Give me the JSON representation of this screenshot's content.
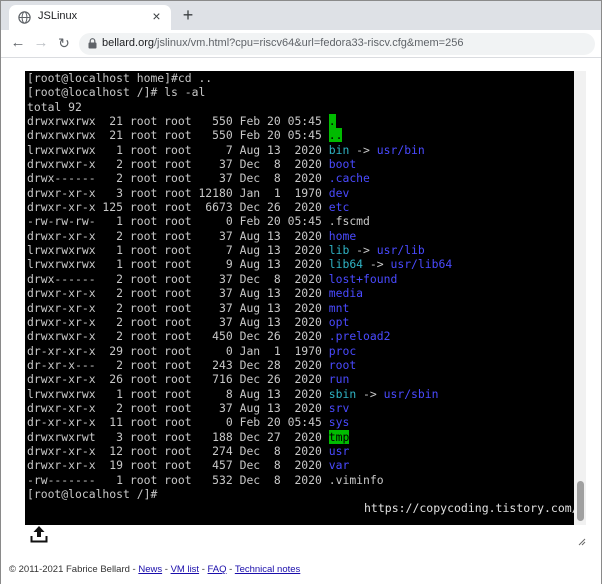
{
  "browser": {
    "tab_title": "JSLinux",
    "new_tab_symbol": "+",
    "close_symbol": "×",
    "url_host": "bellard.org",
    "url_path": "/jslinux/vm.html?cpu=riscv64&url=fedora33-riscv.cfg&mem=256"
  },
  "terminal": {
    "lines": [
      [
        {
          "t": "[root@localhost home]#cd .."
        }
      ],
      [
        {
          "t": "[root@localhost /]# ls -al"
        }
      ],
      [
        {
          "t": "total 92"
        }
      ],
      [
        {
          "t": "drwxrwxrwx  21 root root   550 Feb 20 05:45 "
        },
        {
          "t": ".",
          "c": "c-green-bg"
        }
      ],
      [
        {
          "t": "drwxrwxrwx  21 root root   550 Feb 20 05:45 "
        },
        {
          "t": "..",
          "c": "c-green-bg"
        }
      ],
      [
        {
          "t": "lrwxrwxrwx   1 root root     7 Aug 13  2020 "
        },
        {
          "t": "bin",
          "c": "c-cyan"
        },
        {
          "t": " -> "
        },
        {
          "t": "usr/bin",
          "c": "c-blue"
        }
      ],
      [
        {
          "t": "drwxrwxr-x   2 root root    37 Dec  8  2020 "
        },
        {
          "t": "boot",
          "c": "c-blue"
        }
      ],
      [
        {
          "t": "drwx------   2 root root    37 Dec  8  2020 "
        },
        {
          "t": ".cache",
          "c": "c-blue"
        }
      ],
      [
        {
          "t": "drwxr-xr-x   3 root root 12180 Jan  1  1970 "
        },
        {
          "t": "dev",
          "c": "c-blue"
        }
      ],
      [
        {
          "t": "drwxr-xr-x 125 root root  6673 Dec 26  2020 "
        },
        {
          "t": "etc",
          "c": "c-blue"
        }
      ],
      [
        {
          "t": "-rw-rw-rw-   1 root root     0 Feb 20 05:45 .fscmd"
        }
      ],
      [
        {
          "t": "drwxr-xr-x   2 root root    37 Aug 13  2020 "
        },
        {
          "t": "home",
          "c": "c-blue"
        }
      ],
      [
        {
          "t": "lrwxrwxrwx   1 root root     7 Aug 13  2020 "
        },
        {
          "t": "lib",
          "c": "c-cyan"
        },
        {
          "t": " -> "
        },
        {
          "t": "usr/lib",
          "c": "c-blue"
        }
      ],
      [
        {
          "t": "lrwxrwxrwx   1 root root     9 Aug 13  2020 "
        },
        {
          "t": "lib64",
          "c": "c-cyan"
        },
        {
          "t": " -> "
        },
        {
          "t": "usr/lib64",
          "c": "c-blue"
        }
      ],
      [
        {
          "t": "drwx------   2 root root    37 Dec  8  2020 "
        },
        {
          "t": "lost+found",
          "c": "c-blue"
        }
      ],
      [
        {
          "t": "drwxr-xr-x   2 root root    37 Aug 13  2020 "
        },
        {
          "t": "media",
          "c": "c-blue"
        }
      ],
      [
        {
          "t": "drwxr-xr-x   2 root root    37 Aug 13  2020 "
        },
        {
          "t": "mnt",
          "c": "c-blue"
        }
      ],
      [
        {
          "t": "drwxr-xr-x   2 root root    37 Aug 13  2020 "
        },
        {
          "t": "opt",
          "c": "c-blue"
        }
      ],
      [
        {
          "t": "drwxrwxr-x   2 root root   450 Dec 26  2020 "
        },
        {
          "t": ".preload2",
          "c": "c-blue"
        }
      ],
      [
        {
          "t": "dr-xr-xr-x  29 root root     0 Jan  1  1970 "
        },
        {
          "t": "proc",
          "c": "c-blue"
        }
      ],
      [
        {
          "t": "dr-xr-x---   2 root root   243 Dec 28  2020 "
        },
        {
          "t": "root",
          "c": "c-blue"
        }
      ],
      [
        {
          "t": "drwxr-xr-x  26 root root   716 Dec 26  2020 "
        },
        {
          "t": "run",
          "c": "c-blue"
        }
      ],
      [
        {
          "t": "lrwxrwxrwx   1 root root     8 Aug 13  2020 "
        },
        {
          "t": "sbin",
          "c": "c-cyan"
        },
        {
          "t": " -> "
        },
        {
          "t": "usr/sbin",
          "c": "c-blue"
        }
      ],
      [
        {
          "t": "drwxr-xr-x   2 root root    37 Aug 13  2020 "
        },
        {
          "t": "srv",
          "c": "c-blue"
        }
      ],
      [
        {
          "t": "dr-xr-xr-x  11 root root     0 Feb 20 05:45 "
        },
        {
          "t": "sys",
          "c": "c-blue"
        }
      ],
      [
        {
          "t": "drwxrwxrwt   3 root root   188 Dec 27  2020 "
        },
        {
          "t": "tmp",
          "c": "c-green-bg"
        }
      ],
      [
        {
          "t": "drwxr-xr-x  12 root root   274 Dec  8  2020 "
        },
        {
          "t": "usr",
          "c": "c-blue"
        }
      ],
      [
        {
          "t": "drwxr-xr-x  19 root root   457 Dec  8  2020 "
        },
        {
          "t": "var",
          "c": "c-blue"
        }
      ],
      [
        {
          "t": "-rw-------   1 root root   532 Dec  8  2020 .viminfo"
        }
      ],
      [
        {
          "t": "[root@localhost /]#"
        }
      ]
    ],
    "watermark": "https://copycoding.tistory.com/"
  },
  "footer": {
    "copyright": "© 2011-2021 Fabrice Bellard - ",
    "links": [
      "News",
      "VM list",
      "FAQ",
      "Technical notes"
    ],
    "separator": " - "
  },
  "colors": {
    "terminal_bg": "#000000",
    "terminal_fg": "#c8c8c8",
    "dir_blue": "#4a4aff",
    "link_cyan": "#2fb3c4",
    "highlight_green": "#00bb00"
  },
  "icons": [
    "globe-icon",
    "close-icon",
    "plus-icon",
    "back-arrow-icon",
    "forward-arrow-icon",
    "reload-icon",
    "lock-icon",
    "upload-icon",
    "resize-grip-icon"
  ]
}
